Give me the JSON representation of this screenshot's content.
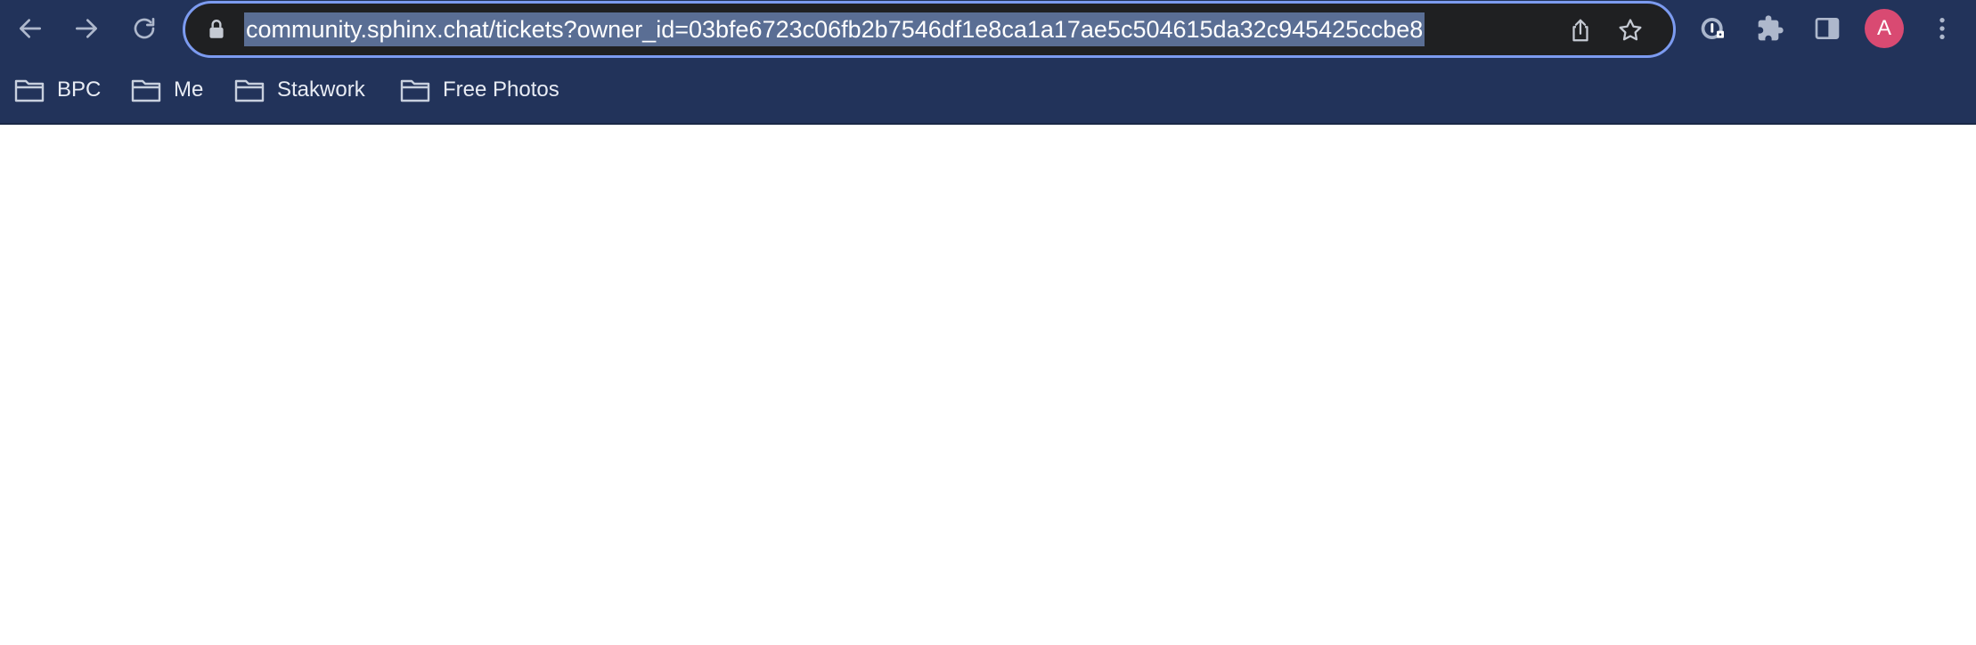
{
  "browser": {
    "url": "community.sphinx.chat/tickets?owner_id=03bfe6723c06fb2b7546df1e8ca1a17ae5c504615da32c945425ccbe8",
    "profile_initial": "A",
    "theme_color": "#22335a",
    "url_highlight_color": "#5a6e94",
    "omnibox_focus_color": "#7c9bf0",
    "avatar_color": "#d94a72"
  },
  "toolbar": {
    "icons": [
      "back-icon",
      "forward-icon",
      "reload-icon",
      "lock-icon",
      "share-icon",
      "star-icon",
      "password-manager-icon",
      "extensions-icon",
      "side-panel-icon",
      "menu-icon"
    ]
  },
  "bookmarks": {
    "items": [
      {
        "label": "BPC",
        "icon": "folder-icon"
      },
      {
        "label": "Me",
        "icon": "folder-icon"
      },
      {
        "label": "Stakwork",
        "icon": "folder-icon"
      },
      {
        "label": "Free Photos",
        "icon": "folder-icon"
      }
    ]
  }
}
